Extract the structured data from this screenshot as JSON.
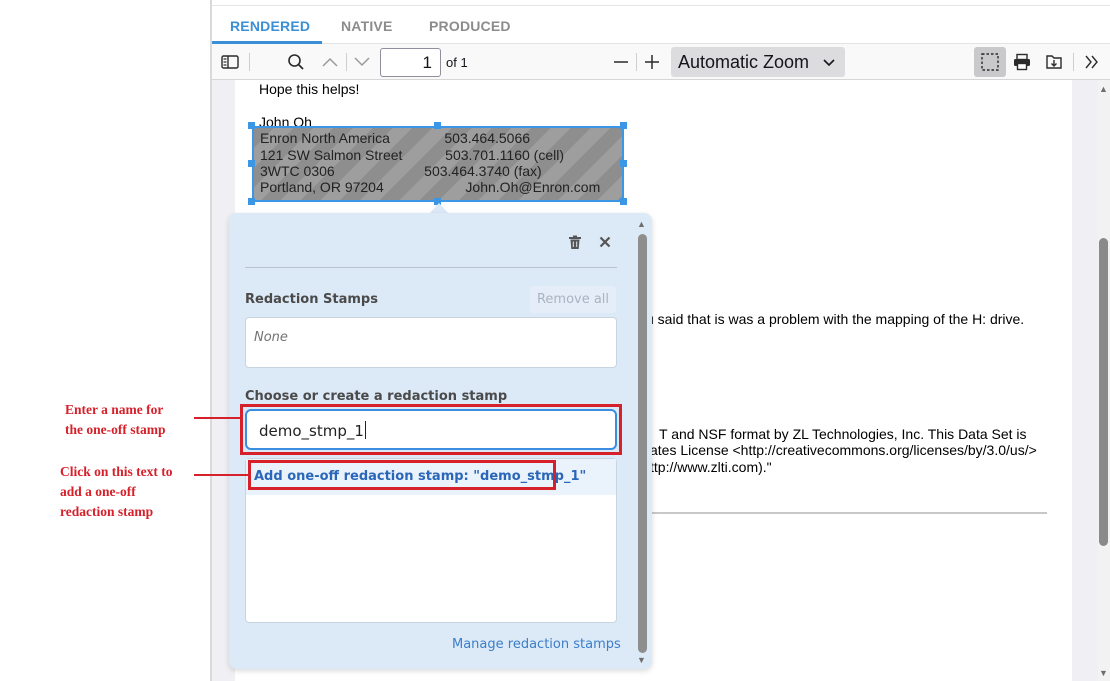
{
  "tabs": [
    {
      "label": "RENDERED",
      "active": true
    },
    {
      "label": "NATIVE",
      "active": false
    },
    {
      "label": "PRODUCED",
      "active": false
    }
  ],
  "toolbar": {
    "page_number": "1",
    "page_total_label": "of 1",
    "zoom_label": "Automatic Zoom"
  },
  "document": {
    "line_hope": "Hope this helps!",
    "line_name": "John Oh",
    "redacted_lines": [
      "Enron North America              503.464.5066",
      "121 SW Salmon Street           503.701.1160 (cell)",
      "3WTC 0306                       503.464.3740 (fax)",
      "Portland, OR 97204                     John.Oh@Enron.com"
    ],
    "line_hdrive": "u said that is was a problem with the mapping of the H: drive.",
    "license_lines": [
      "T and NSF format by ZL Technologies, Inc. This Data Set is",
      "ates License <http://creativecommons.org/licenses/by/3.0/us/>",
      "ttp://www.zlti.com).\""
    ]
  },
  "popup": {
    "section_title": "Redaction Stamps",
    "remove_all_label": "Remove all",
    "stamps_value": "None",
    "choose_label": "Choose or create a redaction stamp",
    "input_value": "demo_stmp_1",
    "suggestion": "Add one-off redaction stamp: \"demo_stmp_1\"",
    "manage_link": "Manage redaction stamps"
  },
  "annotations": {
    "enter_name": [
      "Enter a name for",
      "the one-off stamp"
    ],
    "click_text": [
      "Click on this text to",
      "add a one-off",
      "redaction stamp"
    ]
  },
  "colors": {
    "accent": "#3b8fd6",
    "annotation": "#d6202a",
    "popup_bg": "#dce9f7",
    "link": "#2a67b8"
  }
}
